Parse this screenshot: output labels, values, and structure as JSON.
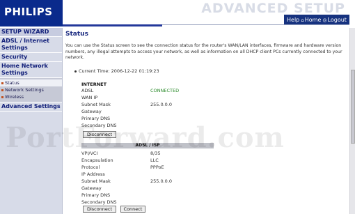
{
  "header": {
    "logo": "PHILIPS",
    "title": "ADVANCED SETUP",
    "nav": {
      "help": "Help",
      "home": "Home",
      "logout": "Logout"
    }
  },
  "sidebar": {
    "setup_wizard": "SETUP WIZARD",
    "adsl_internet": "ADSL / Internet Settings",
    "security": "Security",
    "home_network": "Home Network Settings",
    "sub_items": [
      "Status",
      "Network Settings",
      "Wireless"
    ],
    "advanced": "Advanced Settings"
  },
  "main": {
    "title": "Status",
    "intro": "You can use the Status screen to see the connection status for the router's WAN/LAN interfaces, firmware and hardware version numbers, any illegal attempts to access your network, as well as information on all DHCP client PCs currently connected to your network.",
    "current_time": "Current Time: 2006-12-22 01:19:23",
    "internet": {
      "label": "INTERNET",
      "rows": [
        {
          "k": "ADSL",
          "v": "CONNECTED"
        },
        {
          "k": "WAN IP",
          "v": ""
        },
        {
          "k": "Subnet Mask",
          "v": "255.0.0.0"
        },
        {
          "k": "Gateway",
          "v": ""
        },
        {
          "k": "Primary DNS",
          "v": ""
        },
        {
          "k": "Secondary DNS",
          "v": ""
        }
      ],
      "disconnect": "Disconnect"
    },
    "adsl_isp": {
      "label": "ADSL / ISP",
      "rows": [
        {
          "k": "VPI/VCI",
          "v": "8/35"
        },
        {
          "k": "Encapsulation",
          "v": "LLC"
        },
        {
          "k": "Protocol",
          "v": "PPPoE"
        },
        {
          "k": "IP Address",
          "v": ""
        },
        {
          "k": "Subnet Mask",
          "v": "255.0.0.0"
        },
        {
          "k": "Gateway",
          "v": ""
        },
        {
          "k": "Primary DNS",
          "v": ""
        },
        {
          "k": "Secondary DNS",
          "v": ""
        }
      ],
      "disconnect": "Disconnect",
      "connect": "Connect"
    }
  },
  "watermark": "PortForward.com"
}
